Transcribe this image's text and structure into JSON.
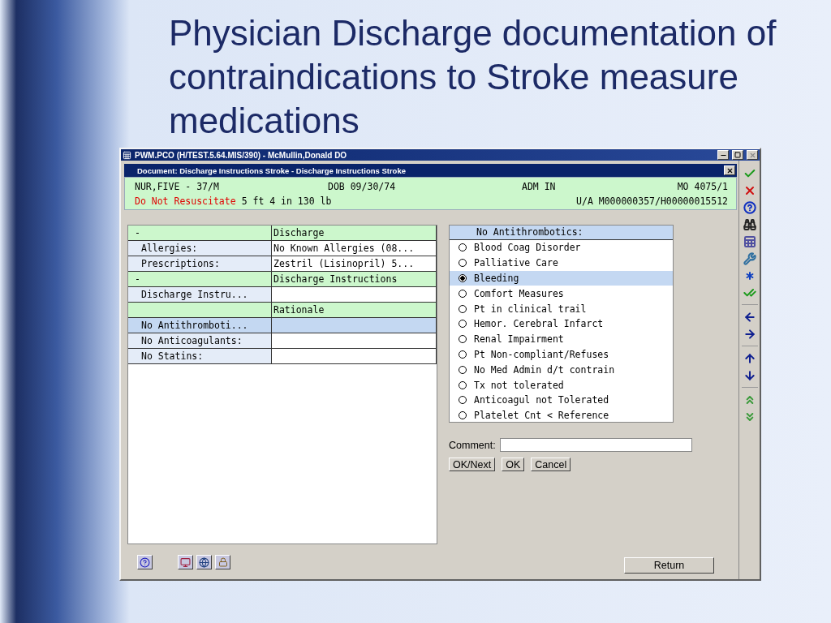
{
  "slide": {
    "title": "Physician Discharge documentation of contraindications to Stroke measure medications"
  },
  "window": {
    "title": "PWM.PCO (H/TEST.5.64.MIS/390) - McMullin,Donald  DO"
  },
  "document": {
    "title": "Document: Discharge Instructions Stroke - Discharge Instructions Stroke"
  },
  "patient": {
    "name": "NUR,FIVE - 37/M",
    "dob": "DOB 09/30/74",
    "admission": "ADM IN",
    "location": "MO 4075/1",
    "code_status": "Do Not Resuscitate",
    "measurements": "5 ft 4 in 130 lb",
    "account": "U/A M000000357/H00000015512"
  },
  "table": {
    "rows": [
      {
        "kind": "header",
        "label": "-",
        "value": "Discharge"
      },
      {
        "kind": "field",
        "label": "Allergies:",
        "value": "No Known Allergies (08...",
        "selected": false
      },
      {
        "kind": "field",
        "label": "Prescriptions:",
        "value": "Zestril (Lisinopril) 5...",
        "selected": false
      },
      {
        "kind": "header",
        "label": "-",
        "value": "Discharge Instructions"
      },
      {
        "kind": "field",
        "label": "Discharge Instru...",
        "selected": false
      },
      {
        "kind": "header",
        "value": "Rationale"
      },
      {
        "kind": "field",
        "label": "No Antithromboti...",
        "selected": true
      },
      {
        "kind": "field",
        "label": "No Anticoagulants:",
        "selected": false
      },
      {
        "kind": "field",
        "label": "No Statins:",
        "selected": false
      }
    ]
  },
  "options": {
    "heading": "No Antithrombotics:",
    "items": [
      {
        "label": "Blood Coag Disorder",
        "selected": false
      },
      {
        "label": "Palliative Care",
        "selected": false
      },
      {
        "label": "Bleeding",
        "selected": true
      },
      {
        "label": "Comfort Measures",
        "selected": false
      },
      {
        "label": "Pt in clinical trail",
        "selected": false
      },
      {
        "label": "Hemor. Cerebral Infarct",
        "selected": false
      },
      {
        "label": "Renal Impairment",
        "selected": false
      },
      {
        "label": "Pt Non-compliant/Refuses",
        "selected": false
      },
      {
        "label": "No Med Admin d/t contrain",
        "selected": false
      },
      {
        "label": "Tx not tolerated",
        "selected": false
      },
      {
        "label": "Anticoagul not Tolerated",
        "selected": false
      },
      {
        "label": "Platelet Cnt < Reference",
        "selected": false
      }
    ]
  },
  "comment": {
    "label": "Comment:"
  },
  "buttons": [
    "OK/Next",
    "OK",
    "Cancel"
  ],
  "return_button": "Return"
}
